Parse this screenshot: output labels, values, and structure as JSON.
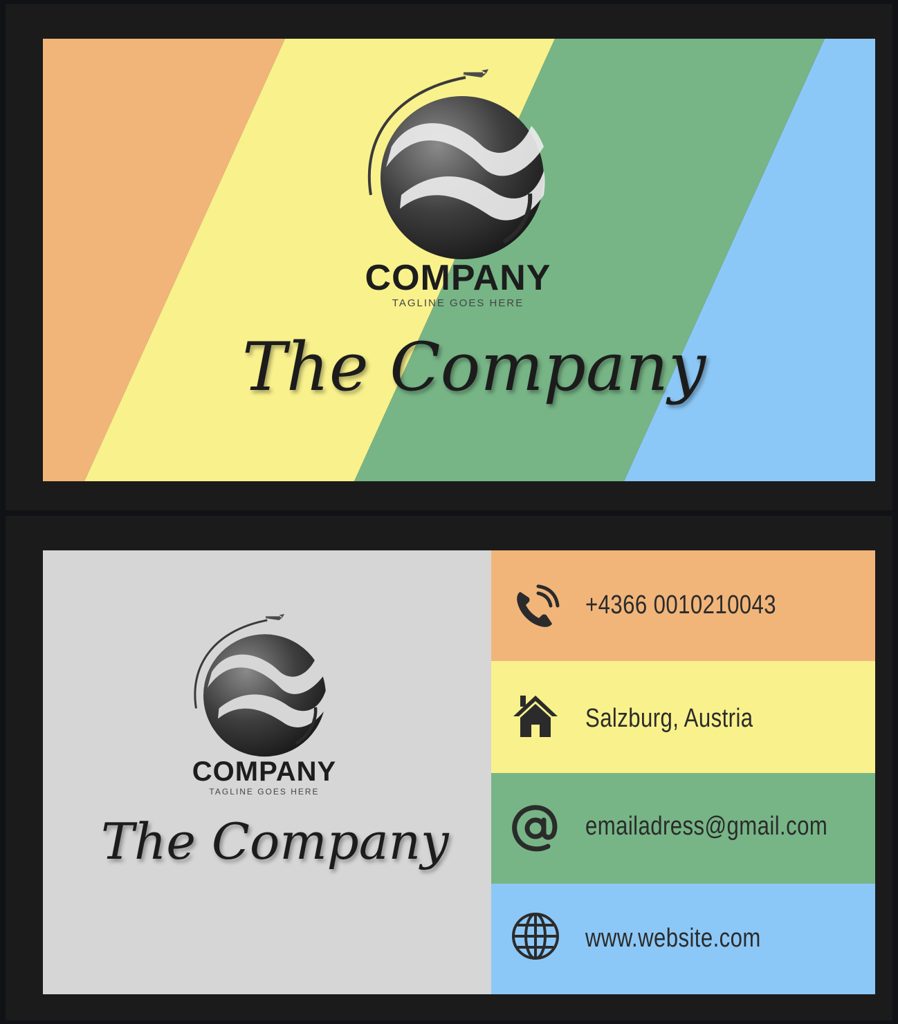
{
  "colors": {
    "orange": "#f1b57a",
    "yellow": "#f9f18c",
    "green": "#77b586",
    "blue": "#8cc8f7",
    "grey": "#d6d6d6",
    "dark": "#1b1b1c"
  },
  "front": {
    "brand": "COMPANY",
    "tagline": "TAGLINE GOES HERE",
    "script_title": "The Company"
  },
  "back": {
    "brand": "COMPANY",
    "tagline": "TAGLINE GOES HERE",
    "script_title": "The Company",
    "contacts": [
      {
        "icon": "phone-icon",
        "text": "+4366 0010210043"
      },
      {
        "icon": "home-icon",
        "text": "Salzburg, Austria"
      },
      {
        "icon": "at-icon",
        "text": "emailadress@gmail.com"
      },
      {
        "icon": "globe-icon",
        "text": "www.website.com"
      }
    ]
  }
}
